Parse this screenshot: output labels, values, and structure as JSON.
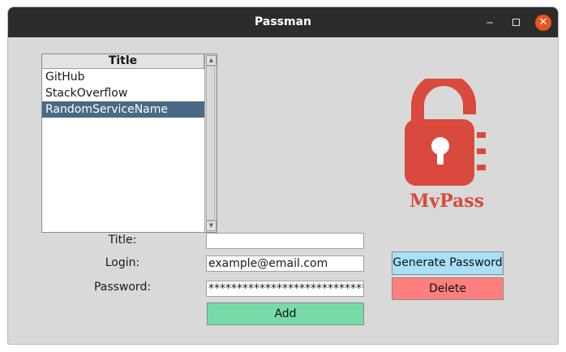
{
  "window": {
    "title": "Passman"
  },
  "titlebar": {
    "minimize_icon": "minimize-icon",
    "maximize_icon": "maximize-icon",
    "close_icon": "close-icon",
    "minimize_glyph": "‒",
    "close_glyph": "✕"
  },
  "list": {
    "header": "Title",
    "items": [
      "GitHub",
      "StackOverflow",
      "RandomServiceName"
    ],
    "selected": "RandomServiceName"
  },
  "logo": {
    "text": "MyPass",
    "icon": "padlock-icon",
    "color": "#d9493d"
  },
  "form": {
    "title_label": "Title:",
    "title_value": "",
    "login_label": "Login:",
    "login_value": "example@email.com",
    "password_label": "Password:",
    "password_value": "******************************"
  },
  "buttons": {
    "add": "Add",
    "generate": "Generate Password",
    "delete": "Delete"
  },
  "colors": {
    "add_bg": "#77dba9",
    "generate_bg": "#a8e0f7",
    "delete_bg": "#ff7f7f",
    "selection_bg": "#4a6984",
    "close_button": "#e95420"
  }
}
